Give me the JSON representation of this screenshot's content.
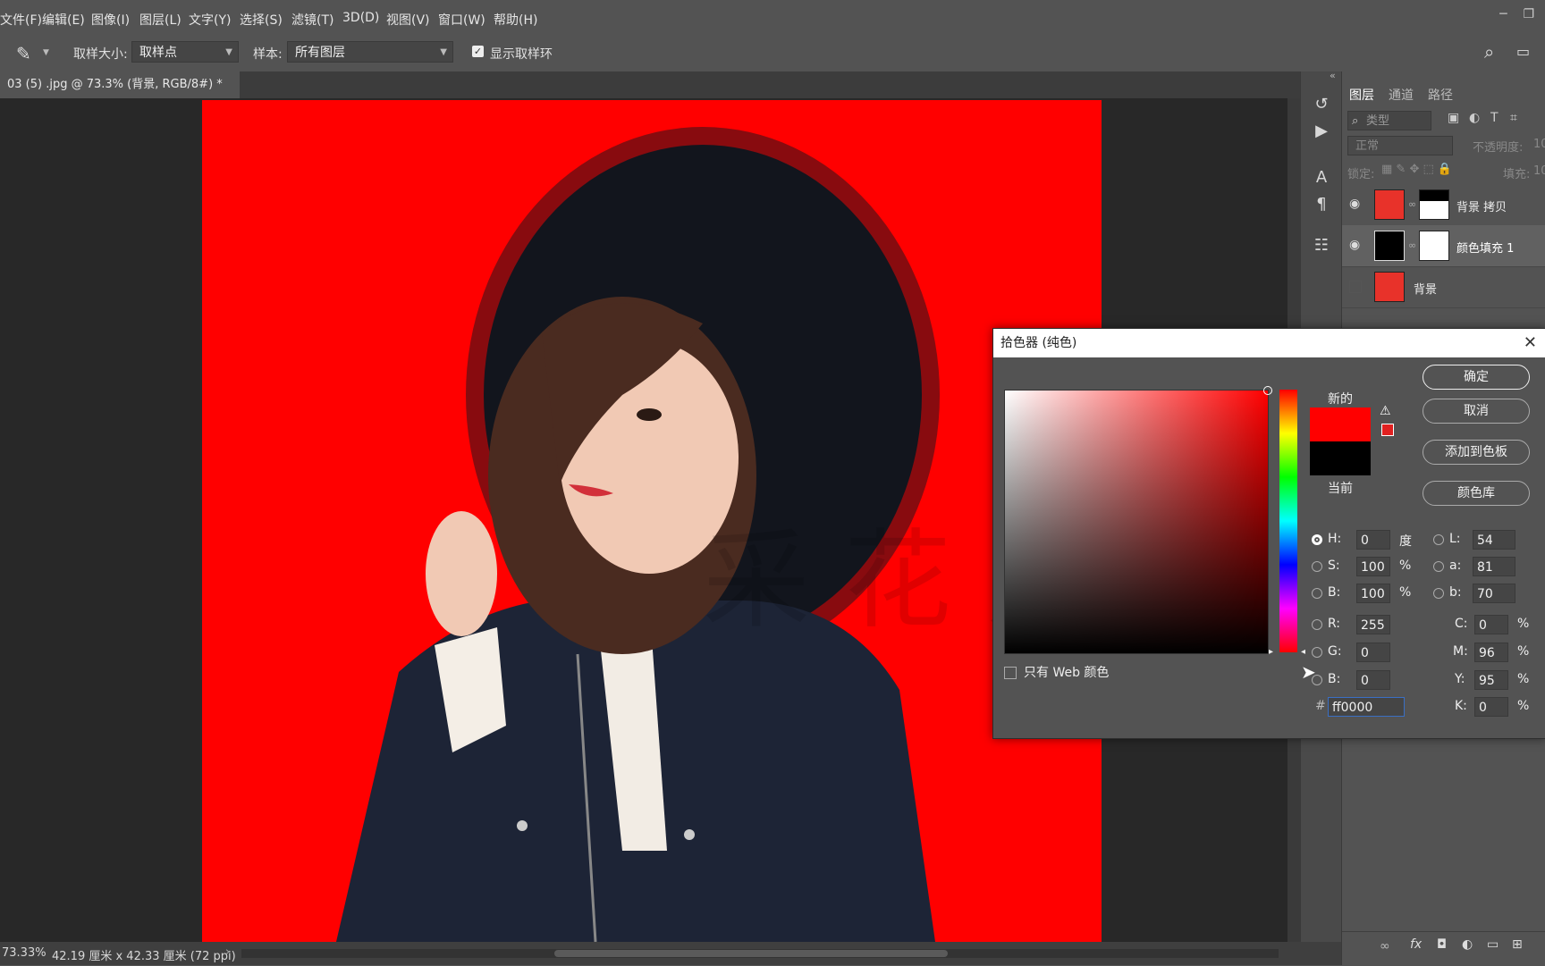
{
  "menu": {
    "items": [
      "文件(F)",
      "编辑(E)",
      "图像(I)",
      "图层(L)",
      "文字(Y)",
      "选择(S)",
      "滤镜(T)",
      "3D(D)",
      "视图(V)",
      "窗口(W)",
      "帮助(H)"
    ]
  },
  "options": {
    "sample_size_label": "取样大小:",
    "sample_size_value": "取样点",
    "sample_label": "样本:",
    "sample_value": "所有图层",
    "show_ring_label": "显示取样环"
  },
  "document": {
    "tab_title": "03 (5) .jpg @ 73.3% (背景, RGB/8#) *",
    "watermark": "采 花 方 六"
  },
  "status": {
    "zoom": "73.33%",
    "size": "42.19 厘米 x 42.33 厘米 (72 ppi)"
  },
  "layers": {
    "tabs": [
      "图层",
      "通道",
      "路径"
    ],
    "filter_placeholder": "类型",
    "blend_mode": "正常",
    "opacity_label": "不透明度:",
    "opacity_value": "10",
    "lock_label": "锁定:",
    "fill_label": "填充:",
    "fill_value": "10",
    "items": [
      {
        "name": "背景 拷贝"
      },
      {
        "name": "颜色填充 1"
      },
      {
        "name": "背景"
      }
    ]
  },
  "dialog": {
    "title": "拾色器 (纯色)",
    "new_label": "新的",
    "current_label": "当前",
    "new_color": "#ff0000",
    "current_color": "#000000",
    "buttons": {
      "ok": "确定",
      "cancel": "取消",
      "add_swatch": "添加到色板",
      "libraries": "颜色库"
    },
    "web_only_label": "只有 Web 颜色",
    "fields": {
      "H": "0",
      "S": "100",
      "B": "100",
      "R": "255",
      "G": "0",
      "Bb": "0",
      "L": "54",
      "a": "81",
      "lab_b": "70",
      "C": "0",
      "M": "96",
      "Y": "95",
      "K": "0",
      "hex": "ff0000"
    },
    "labels": {
      "H": "H:",
      "S": "S:",
      "B": "B:",
      "R": "R:",
      "G": "G:",
      "Bb": "B:",
      "L": "L:",
      "a": "a:",
      "lab_b": "b:",
      "C": "C:",
      "M": "M:",
      "Y": "Y:",
      "K": "K:",
      "hex": "#"
    },
    "units": {
      "deg": "度",
      "pct": "%"
    }
  }
}
